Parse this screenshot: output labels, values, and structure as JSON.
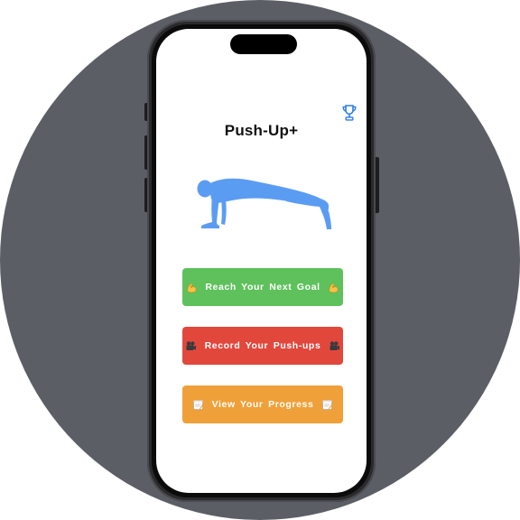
{
  "app": {
    "title": "Push-Up+"
  },
  "header": {
    "trophy_icon": "trophy-icon"
  },
  "illustration": {
    "icon": "push-up-figure-icon",
    "color": "#5b9cf3"
  },
  "actions": [
    {
      "label": "Reach Your Next Goal",
      "icon": "flexed-biceps-icon",
      "color": "#5ec15c"
    },
    {
      "label": "Record Your Push-ups",
      "icon": "video-camera-icon",
      "color": "#e2473c"
    },
    {
      "label": "View Your Progress",
      "icon": "memo-icon",
      "color": "#f0a038"
    }
  ],
  "colors": {
    "accent": "#2f7de1",
    "backdrop": "#5b5f65"
  }
}
